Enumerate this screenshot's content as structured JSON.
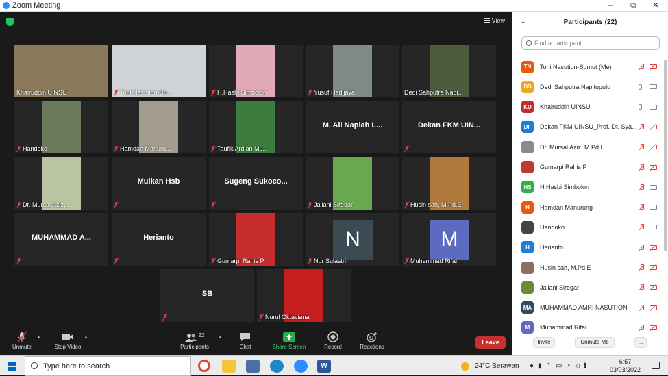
{
  "window": {
    "title": "Zoom Meeting",
    "minimize": "–",
    "restore": "⧉",
    "close": "✕"
  },
  "meeting": {
    "view_label": "View",
    "tiles": [
      {
        "name": "Khairuddin UINSU",
        "kind": "video",
        "muted": false,
        "active": true
      },
      {
        "name": "Toni Nasution-Su...",
        "kind": "video",
        "muted": true
      },
      {
        "name": "H.Hasbi Simbolon",
        "kind": "video",
        "muted": true
      },
      {
        "name": "Yusuf Hadijaya",
        "kind": "video",
        "muted": true
      },
      {
        "name": "Dedi Sahputra Napi...",
        "kind": "video",
        "muted": false
      },
      {
        "name": "Handoko",
        "kind": "video",
        "muted": true
      },
      {
        "name": "Hamdan Manuru...",
        "kind": "video",
        "muted": true
      },
      {
        "name": "Taufik Ardian Mu...",
        "kind": "video",
        "muted": true
      },
      {
        "name": "",
        "big": "M. Ali Napiah L...",
        "kind": "name",
        "muted": false
      },
      {
        "name": "",
        "big": "Dekan FKM UIN...",
        "kind": "name",
        "muted": true
      },
      {
        "name": "Dr. Mursal Aziz, ...",
        "kind": "video",
        "muted": true
      },
      {
        "name": "",
        "big": "Mulkan Hsb",
        "kind": "name",
        "muted": true
      },
      {
        "name": "",
        "big": "Sugeng  Sukoco...",
        "kind": "name",
        "muted": true
      },
      {
        "name": "Jailani Siregar",
        "kind": "video",
        "muted": true
      },
      {
        "name": "Husin sah, M.Pd.E",
        "kind": "video",
        "muted": true
      },
      {
        "name": "",
        "big": "MUHAMMAD  A...",
        "kind": "name",
        "muted": true
      },
      {
        "name": "",
        "big": "Herianto",
        "kind": "name",
        "muted": true
      },
      {
        "name": "Gumarpi Rahis P",
        "kind": "video",
        "muted": true
      },
      {
        "name": "Nur Sulastri",
        "kind": "letter",
        "letter": "N",
        "muted": true
      },
      {
        "name": "Muhammad Rifai",
        "kind": "letter",
        "letter": "M",
        "muted": true
      },
      {
        "name": "",
        "big": "SB",
        "kind": "name",
        "muted": true
      },
      {
        "name": "Nurul Oktaviana",
        "kind": "video",
        "muted": true
      }
    ]
  },
  "toolbar": {
    "unmute": "Unmute",
    "stop_video": "Stop Video",
    "participants": "Participants",
    "participants_count": "22",
    "chat": "Chat",
    "share_screen": "Share Screen",
    "record": "Record",
    "reactions": "Reactions",
    "leave": "Leave"
  },
  "panel": {
    "title": "Participants (22)",
    "search_placeholder": "Find a participant",
    "participants": [
      {
        "initials": "TN",
        "color": "#e8590c",
        "name": "Toni Nasution-Sumut (Me)",
        "mic": "muted",
        "cam": "off"
      },
      {
        "initials": "DS",
        "color": "#f2a516",
        "name": "Dedi Sahputra Napitupulu",
        "mic": "on",
        "cam": "on"
      },
      {
        "initials": "KU",
        "color": "#c92a2a",
        "name": "Khairuddin UINSU",
        "mic": "on",
        "cam": "on"
      },
      {
        "initials": "DF",
        "color": "#1c7ed6",
        "name": "Dekan FKM UINSU_Prof. Dr. Sya...",
        "mic": "muted",
        "cam": "off"
      },
      {
        "initials": "",
        "color": "#8a8a8a",
        "name": "Dr. Mursal Aziz, M.Pd.I",
        "mic": "muted",
        "cam": "off"
      },
      {
        "initials": "",
        "color": "#c0392b",
        "name": "Gumarpi Rahis P",
        "mic": "muted",
        "cam": "off"
      },
      {
        "initials": "HS",
        "color": "#2fb344",
        "name": "H.Hasbi Simbolon",
        "mic": "muted",
        "cam": "on"
      },
      {
        "initials": "H",
        "color": "#e8590c",
        "name": "Hamdan Manurung",
        "mic": "muted",
        "cam": "on"
      },
      {
        "initials": "",
        "color": "#444444",
        "name": "Handoko",
        "mic": "muted",
        "cam": "on"
      },
      {
        "initials": "H",
        "color": "#1c7ed6",
        "name": "Herianto",
        "mic": "muted",
        "cam": "off"
      },
      {
        "initials": "",
        "color": "#8d6e63",
        "name": "Husin sah, M.Pd.E",
        "mic": "muted",
        "cam": "off"
      },
      {
        "initials": "",
        "color": "#6d8b3a",
        "name": "Jailani Siregar",
        "mic": "muted",
        "cam": "off"
      },
      {
        "initials": "MA",
        "color": "#34495e",
        "name": "MUHAMMAD AMRI NASUTION",
        "mic": "muted",
        "cam": "off"
      },
      {
        "initials": "M",
        "color": "#5c6bc0",
        "name": "Muhammad Rifai",
        "mic": "muted",
        "cam": "off"
      }
    ],
    "invite": "Invite",
    "unmute_me": "Unmute Me",
    "more": "..."
  },
  "taskbar": {
    "search_placeholder": "Type here to search",
    "weather": "24°C  Berawan",
    "time": "6:57",
    "date": "03/03/2022"
  }
}
